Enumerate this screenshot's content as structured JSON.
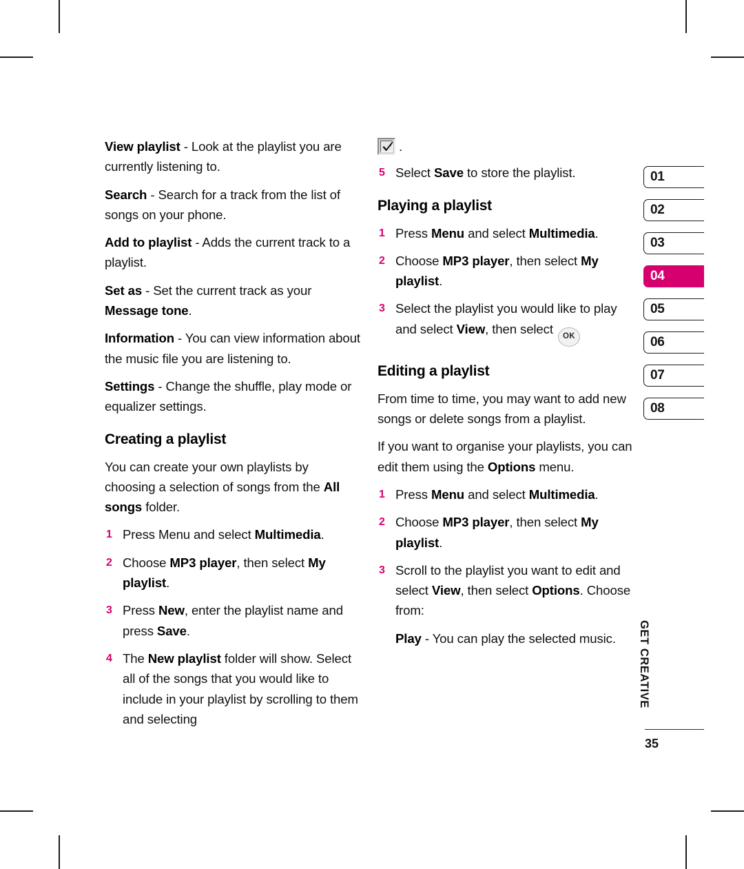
{
  "colors": {
    "accent": "#D6006E",
    "text": "#111111",
    "rule": "#2b2b2b"
  },
  "left_column": {
    "definitions": [
      {
        "term": "View playlist",
        "rest": " - Look at the playlist you are currently listening to."
      },
      {
        "term": "Search",
        "rest": " - Search for a track from the list of songs on your phone."
      },
      {
        "term": "Add to playlist",
        "rest": " - Adds the current track to a playlist."
      },
      {
        "term": "Set as",
        "rest": " - Set the current track as your ",
        "term2": "Message tone",
        "rest2": "."
      },
      {
        "term": "Information",
        "rest": " - You can view information about the music file you are listening to."
      },
      {
        "term": "Settings",
        "rest": " - Change the shuffle, play mode or equalizer settings."
      }
    ],
    "heading": "Creating a playlist",
    "intro": {
      "a": "You can create your own playlists by choosing a selection of songs from the ",
      "b": "All songs",
      "c": " folder."
    },
    "steps": [
      {
        "num": "1",
        "a": "Press Menu and select ",
        "b": "Multimedia",
        "c": "."
      },
      {
        "num": "2",
        "a": "Choose ",
        "b": "MP3 player",
        "c": ", then select ",
        "d": "My playlist",
        "e": "."
      },
      {
        "num": "3",
        "a": "Press ",
        "b": "New",
        "c": ", enter the playlist name and press ",
        "d": "Save",
        "e": "."
      },
      {
        "num": "4",
        "a": "The ",
        "b": "New playlist",
        "c": " folder will show. Select all of the songs that you would like to include in your playlist by scrolling to them and selecting"
      }
    ]
  },
  "right_column": {
    "orphan": {
      "icon": "checkbox-checked-icon",
      "trailing": "."
    },
    "step5": {
      "num": "5",
      "a": "Select ",
      "b": "Save",
      "c": " to store the playlist."
    },
    "playing": {
      "heading": "Playing a playlist",
      "steps": [
        {
          "num": "1",
          "a": "Press ",
          "b": "Menu",
          "c": " and select ",
          "d": "Multimedia",
          "e": "."
        },
        {
          "num": "2",
          "a": "Choose ",
          "b": "MP3 player",
          "c": ", then select ",
          "d": "My playlist",
          "e": "."
        },
        {
          "num": "3",
          "a": "Select the playlist you would like to play and select ",
          "b": "View",
          "c": ", then select ",
          "icon": "ok-key-icon",
          "icon_label": "OK"
        }
      ]
    },
    "editing": {
      "heading": "Editing a playlist",
      "para1": "From time to time, you may want to add new songs or delete songs from a playlist.",
      "para2": {
        "a": "If you want to organise your playlists, you can edit them using the ",
        "b": "Options",
        "c": " menu."
      },
      "steps": [
        {
          "num": "1",
          "a": "Press ",
          "b": "Menu",
          "c": " and select ",
          "d": "Multimedia",
          "e": "."
        },
        {
          "num": "2",
          "a": "Choose ",
          "b": "MP3 player",
          "c": ", then select ",
          "d": "My playlist",
          "e": "."
        },
        {
          "num": "3",
          "a": "Scroll to the playlist you want to edit and select ",
          "b": "View",
          "c": ", then select ",
          "d": "Options",
          "e": ". Choose from:"
        }
      ],
      "substep": {
        "b": "Play",
        "rest": " - You can play the selected music."
      }
    }
  },
  "sidebar": {
    "tabs": [
      {
        "label": "01",
        "active": false
      },
      {
        "label": "02",
        "active": false
      },
      {
        "label": "03",
        "active": false
      },
      {
        "label": "04",
        "active": true
      },
      {
        "label": "05",
        "active": false
      },
      {
        "label": "06",
        "active": false
      },
      {
        "label": "07",
        "active": false
      },
      {
        "label": "08",
        "active": false
      }
    ],
    "chapter_title": "GET CREATIVE",
    "page_number": "35"
  }
}
